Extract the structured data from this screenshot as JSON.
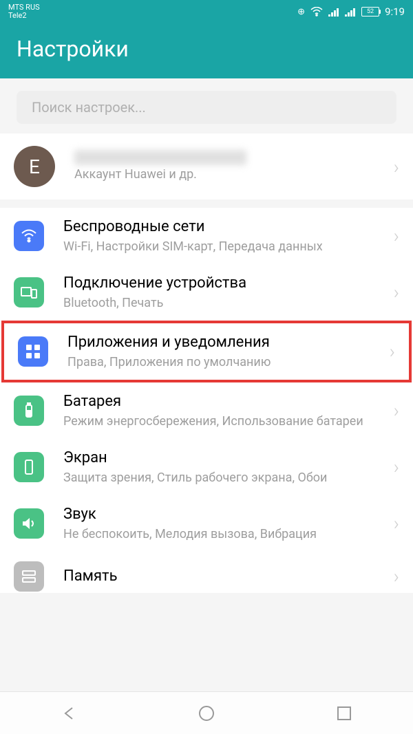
{
  "status": {
    "carrier1": "MTS RUS",
    "carrier2": "Tele2",
    "battery": "52",
    "time": "9:19"
  },
  "header": {
    "title": "Настройки"
  },
  "search": {
    "placeholder": "Поиск настроек..."
  },
  "profile": {
    "initial": "E",
    "sub": "Аккаунт Huawei и др."
  },
  "items": [
    {
      "title": "Беспроводные сети",
      "sub": "Wi-Fi, Настройки SIM-карт, Передача данных",
      "color": "#4a7af8",
      "icon": "wifi"
    },
    {
      "title": "Подключение устройства",
      "sub": "Bluetooth, Печать",
      "color": "#4ac285",
      "icon": "devices"
    },
    {
      "title": "Приложения и уведомления",
      "sub": "Права, Приложения по умолчанию",
      "color": "#4a7af8",
      "icon": "apps",
      "highlight": true
    },
    {
      "title": "Батарея",
      "sub": "Режим энергосбережения, Использование батареи",
      "color": "#4ac285",
      "icon": "battery"
    },
    {
      "title": "Экран",
      "sub": "Защита зрения, Стиль рабочего экрана, Обои",
      "color": "#4ac285",
      "icon": "display"
    },
    {
      "title": "Звук",
      "sub": "Не беспокоить, Мелодия вызова, Вибрация",
      "color": "#4ac285",
      "icon": "sound"
    },
    {
      "title": "Память",
      "sub": "",
      "color": "#bdbdbd",
      "icon": "storage"
    }
  ]
}
